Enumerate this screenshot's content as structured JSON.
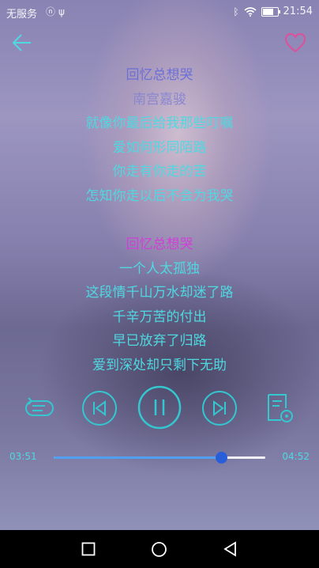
{
  "status_bar": {
    "carrier": "无服务",
    "time": "21:54",
    "battery_level": 0.85
  },
  "header": {
    "back_icon": "arrow-left-icon",
    "favorite_icon": "heart-outline-icon"
  },
  "lyrics": {
    "title": "回忆总想哭",
    "artist": "南宫嘉骏",
    "lines_before": [
      "就像你最后给我那些叮嘱",
      "爱如何形同陌路",
      "你走有你走的苦",
      "怎知你走以后不会为我哭"
    ],
    "current_line": "回忆总想哭",
    "lines_after": [
      "一个人太孤独",
      "这段情千山万水却迷了路",
      "千辛万苦的付出",
      "早已放弃了归路",
      "爱到深处却只剩下无助"
    ]
  },
  "controls": {
    "playlist_icon": "playlist-icon",
    "prev_icon": "skip-previous-icon",
    "pause_icon": "pause-icon",
    "next_icon": "skip-next-icon",
    "lyrics_icon": "lyrics-file-icon"
  },
  "progress": {
    "elapsed": "03:51",
    "total": "04:52",
    "fraction": 0.79
  },
  "colors": {
    "accent": "#4fd8e0",
    "current_line": "#d13fd6",
    "title": "#6b6fd6",
    "progress": "#2a5ed8",
    "heart": "#e0509a"
  },
  "nav_bar": {
    "recent_icon": "square-icon",
    "home_icon": "circle-icon",
    "back_icon": "triangle-back-icon"
  }
}
